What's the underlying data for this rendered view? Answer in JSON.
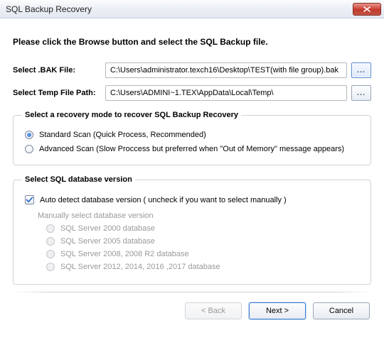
{
  "titlebar": {
    "title": "SQL Backup Recovery"
  },
  "instruction": "Please click the Browse button and select the SQL Backup file.",
  "file_fields": {
    "bak": {
      "label": "Select .BAK File:",
      "value": "C:\\Users\\administrator.texch16\\Desktop\\TEST(with file group).bak"
    },
    "temp": {
      "label": "Select Temp File Path:",
      "value": "C:\\Users\\ADMINI~1.TEX\\AppData\\Local\\Temp\\"
    },
    "browse_label": "..."
  },
  "scan_group": {
    "legend": "Select a recovery mode to recover SQL Backup Recovery",
    "standard": "Standard Scan (Quick Process, Recommended)",
    "advanced": "Advanced Scan (Slow Proccess but preferred when \"Out of Memory\" message appears)",
    "selected": "standard"
  },
  "version_group": {
    "legend": "Select SQL database version",
    "auto_label": "Auto detect database version ( uncheck if you want to select manually )",
    "auto_checked": true,
    "manual_label": "Manually select database version",
    "options": {
      "v2000": "SQL Server 2000 database",
      "v2005": "SQL Server 2005 database",
      "v2008": "SQL Server 2008, 2008 R2 database",
      "v2012": "SQL Server 2012, 2014, 2016 ,2017 database"
    }
  },
  "buttons": {
    "back": "< Back",
    "next": "Next >",
    "cancel": "Cancel"
  }
}
